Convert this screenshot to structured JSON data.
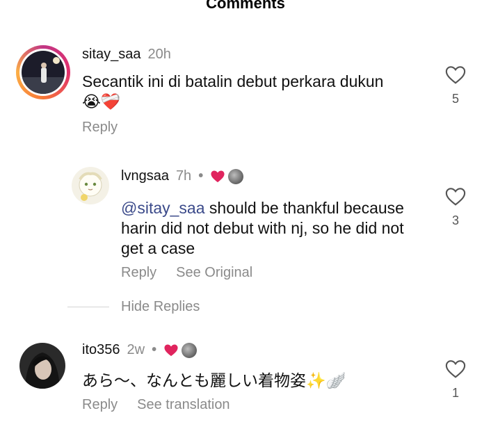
{
  "header": {
    "title": "Comments"
  },
  "comments": [
    {
      "username": "sitay_saa",
      "time": "20h",
      "text": "Secantik ini di batalin debut perkara dukun😭❤️‍🩹",
      "like_count": "5",
      "actions": {
        "reply": "Reply"
      },
      "avatar_icon": "user-photo-icon"
    },
    {
      "username": "lvngsaa",
      "time": "7h",
      "separator": "•",
      "mention": "@sitay_saa",
      "text": " should be thankful because harin did not debut with nj, so he did not get a case",
      "like_count": "3",
      "actions": {
        "reply": "Reply",
        "see_original": "See Original"
      },
      "avatar_icon": "anime-avatar-icon"
    },
    {
      "username": "ito356",
      "time": "2w",
      "separator": "•",
      "text": "あら〜、なんとも麗しい着物姿✨🪽",
      "like_count": "1",
      "actions": {
        "reply": "Reply",
        "see_translation": "See translation"
      },
      "avatar_icon": "user-photo-icon"
    }
  ],
  "hide_replies": "Hide Replies",
  "colors": {
    "author_heart": "#e0245e",
    "mention": "#3b4a8a",
    "muted": "#8a8a8a"
  }
}
